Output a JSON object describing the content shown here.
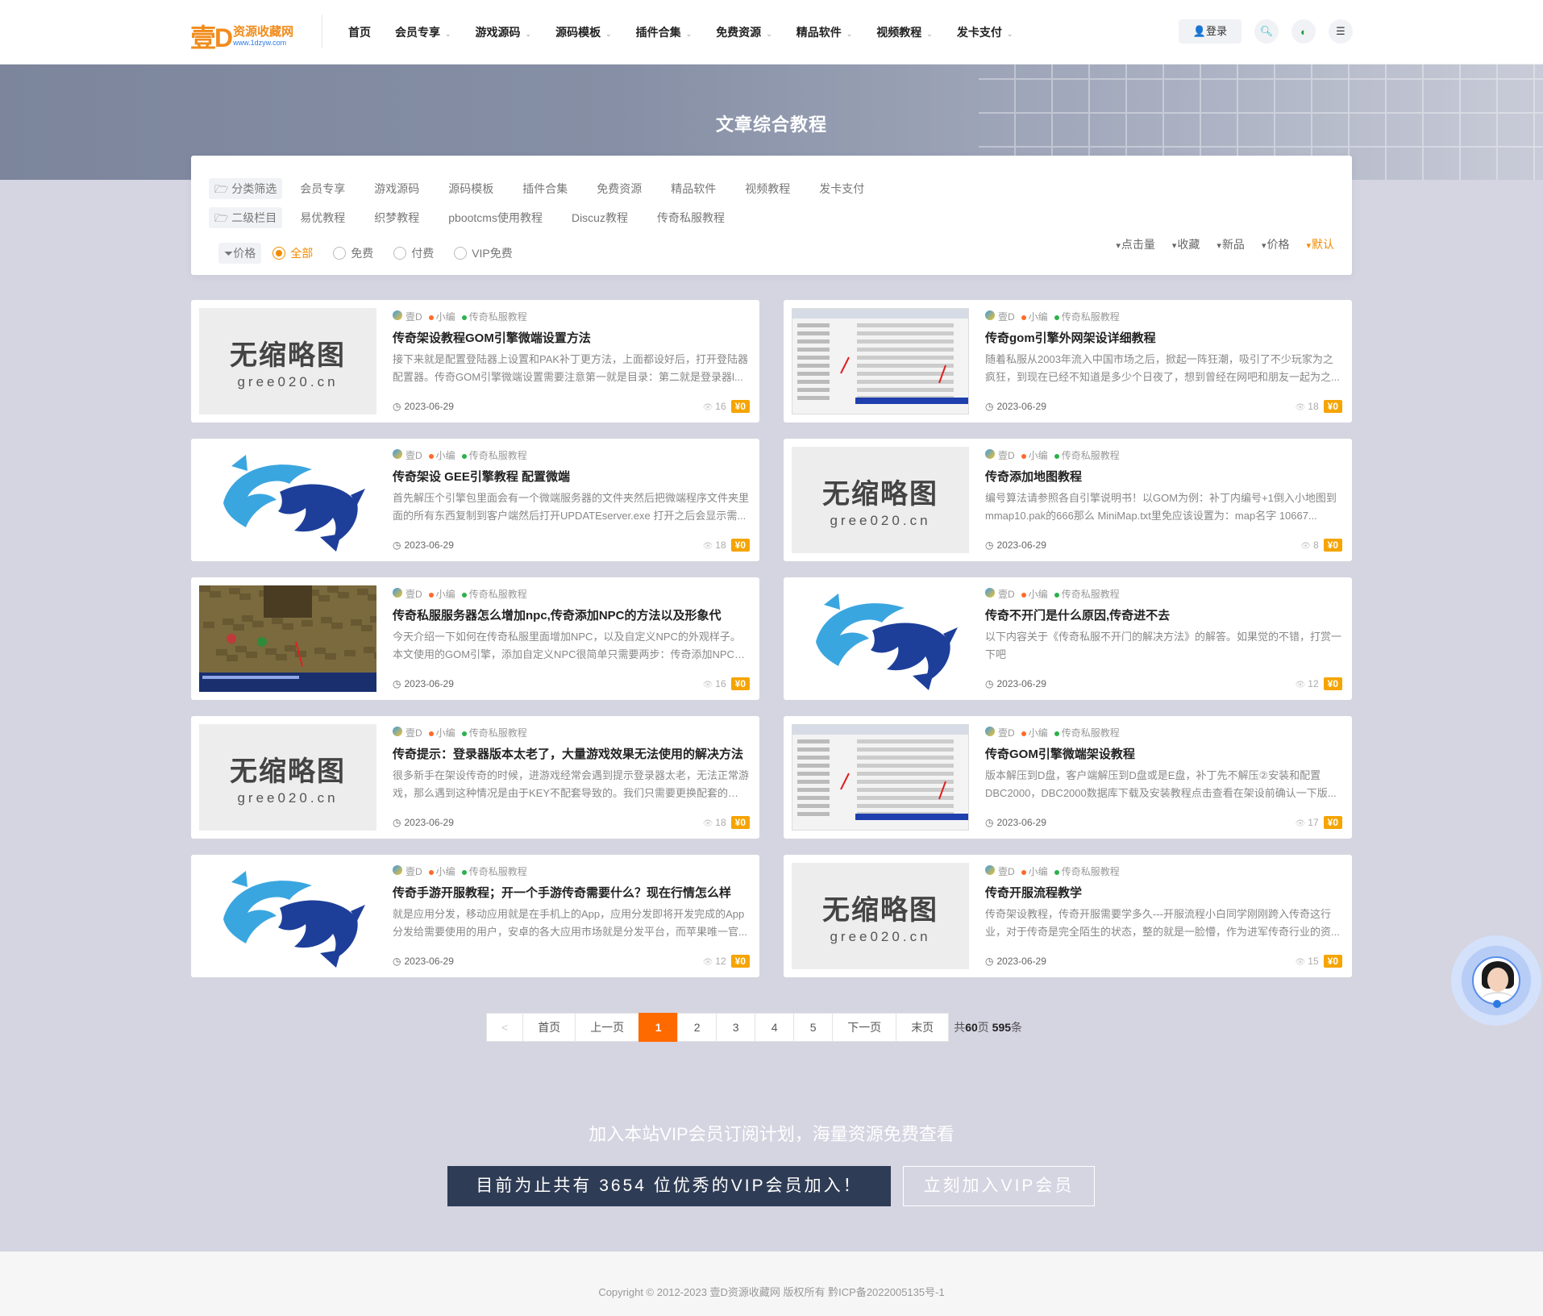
{
  "header": {
    "logo_mark": "壹D",
    "logo_name": "资源收藏网",
    "logo_url": "www.1dzyw.com",
    "nav": [
      {
        "label": "首页",
        "has_caret": false
      },
      {
        "label": "会员专享",
        "has_caret": true
      },
      {
        "label": "游戏源码",
        "has_caret": true
      },
      {
        "label": "源码模板",
        "has_caret": true
      },
      {
        "label": "插件合集",
        "has_caret": true
      },
      {
        "label": "免费资源",
        "has_caret": true
      },
      {
        "label": "精品软件",
        "has_caret": true
      },
      {
        "label": "视频教程",
        "has_caret": true
      },
      {
        "label": "发卡支付",
        "has_caret": true
      }
    ],
    "login_label": "登录",
    "icons": [
      "user-icon",
      "search-icon",
      "theme-toggle-icon",
      "menu-icon"
    ]
  },
  "hero": {
    "title": "文章综合教程"
  },
  "filter": {
    "cat_label": "分类筛选",
    "categories": [
      "会员专享",
      "游戏源码",
      "源码模板",
      "插件合集",
      "免费资源",
      "精品软件",
      "视频教程",
      "发卡支付"
    ],
    "sub_label": "二级栏目",
    "subcategories": [
      "易优教程",
      "织梦教程",
      "pbootcms使用教程",
      "Discuz教程",
      "传奇私服教程"
    ],
    "price_label": "价格",
    "price_options": [
      {
        "label": "全部",
        "selected": true
      },
      {
        "label": "免费",
        "selected": false
      },
      {
        "label": "付费",
        "selected": false
      },
      {
        "label": "VIP免费",
        "selected": false
      }
    ],
    "sorts": [
      {
        "label": "点击量",
        "active": false
      },
      {
        "label": "收藏",
        "active": false
      },
      {
        "label": "新品",
        "active": false
      },
      {
        "label": "价格",
        "active": false
      },
      {
        "label": "默认",
        "active": true
      }
    ]
  },
  "posts": [
    {
      "thumb": "nothumb",
      "site": "壹D",
      "author": "小编",
      "category": "传奇私服教程",
      "title": "传奇架设教程GOM引擎微端设置方法",
      "desc": "接下来就是配置登陆器上设置和PAK补丁更方法，上面都设好后，打开登陆器配置器。传奇GOM引擎微端设置需要注意第一就是目录：第二就是登录器l...",
      "date": "2023-06-29",
      "views": "16",
      "price": "¥0"
    },
    {
      "thumb": "shot",
      "site": "壹D",
      "author": "小编",
      "category": "传奇私服教程",
      "title": "传奇gom引擎外网架设详细教程",
      "desc": "随着私服从2003年流入中国市场之后，掀起一阵狂潮，吸引了不少玩家为之疯狂，到现在已经不知道是多少个日夜了，想到曾经在网吧和朋友一起为之...",
      "date": "2023-06-29",
      "views": "18",
      "price": "¥0"
    },
    {
      "thumb": "fish",
      "site": "壹D",
      "author": "小编",
      "category": "传奇私服教程",
      "title": "传奇架设 GEE引擎教程 配置微端",
      "desc": "首先解压个引擎包里面会有一个微端服务器的文件夹然后把微端程序文件夹里面的所有东西复制到客户端然后打开UPDATEserver.exe 打开之后会显示需...",
      "date": "2023-06-29",
      "views": "18",
      "price": "¥0"
    },
    {
      "thumb": "nothumb",
      "site": "壹D",
      "author": "小编",
      "category": "传奇私服教程",
      "title": "传奇添加地图教程",
      "desc": "编号算法请参照各自引擎说明书！以GOM为例：补丁内编号+1倒入小地图到mmap10.pak的666那么 MiniMap.txt里免应该设置为：map名字 10667...",
      "date": "2023-06-29",
      "views": "8",
      "price": "¥0"
    },
    {
      "thumb": "game",
      "site": "壹D",
      "author": "小编",
      "category": "传奇私服教程",
      "title": "传奇私服服务器怎么增加npc,传奇添加NPC的方法以及形象代",
      "desc": "今天介绍一下如何在传奇私服里面增加NPC，以及自定义NPC的外观样子。本文使用的GOM引擎，添加自定义NPC很简单只需要两步：传奇添加NPC的...",
      "date": "2023-06-29",
      "views": "16",
      "price": "¥0"
    },
    {
      "thumb": "fish",
      "site": "壹D",
      "author": "小编",
      "category": "传奇私服教程",
      "title": "传奇不开门是什么原因,传奇进不去",
      "desc": "以下内容关于《传奇私服不开门的解决方法》的解答。如果觉的不错，打赏一下吧",
      "date": "2023-06-29",
      "views": "12",
      "price": "¥0"
    },
    {
      "thumb": "nothumb",
      "site": "壹D",
      "author": "小编",
      "category": "传奇私服教程",
      "title": "传奇提示：登录器版本太老了，大量游戏效果无法使用的解决方法",
      "desc": "很多新手在架设传奇的时候，进游戏经常会遇到提示登录器太老，无法正常游戏，那么遇到这种情况是由于KEY不配套导致的。我们只需要更换配套的KE...",
      "date": "2023-06-29",
      "views": "18",
      "price": "¥0"
    },
    {
      "thumb": "shot",
      "site": "壹D",
      "author": "小编",
      "category": "传奇私服教程",
      "title": "传奇GOM引擎微端架设教程",
      "desc": "版本解压到D盘，客户端解压到D盘或是E盘，补丁先不解压②安装和配置DBC2000，DBC2000数据库下载及安装教程点击查看在架设前确认一下版...",
      "date": "2023-06-29",
      "views": "17",
      "price": "¥0"
    },
    {
      "thumb": "fish",
      "site": "壹D",
      "author": "小编",
      "category": "传奇私服教程",
      "title": "传奇手游开服教程；开一个手游传奇需要什么？现在行情怎么样",
      "desc": "就是应用分发，移动应用就是在手机上的App，应用分发即将开发完成的App分发给需要使用的用户，安卓的各大应用市场就是分发平台，而苹果唯一官...",
      "date": "2023-06-29",
      "views": "12",
      "price": "¥0"
    },
    {
      "thumb": "nothumb",
      "site": "壹D",
      "author": "小编",
      "category": "传奇私服教程",
      "title": "传奇开服流程教学",
      "desc": "传奇架设教程，传奇开服需要学多久---开服流程小白同学刚刚跨入传奇这行业，对于传奇是完全陌生的状态，整的就是一脸懵，作为进军传奇行业的资...",
      "date": "2023-06-29",
      "views": "15",
      "price": "¥0"
    }
  ],
  "nothumb_text": {
    "line1": "无缩略图",
    "line2": "gree020.cn"
  },
  "pagination": {
    "prev_arrow": "<",
    "first": "首页",
    "prev": "上一页",
    "pages": [
      "1",
      "2",
      "3",
      "4",
      "5"
    ],
    "current": "1",
    "next": "下一页",
    "last": "末页",
    "total_prefix": "共",
    "total_pages": "60",
    "total_pages_suffix": "页",
    "total_items": "595",
    "total_items_suffix": "条"
  },
  "vip": {
    "title": "加入本站VIP会员订阅计划，海量资源免费查看",
    "count_text": "目前为止共有 3654 位优秀的VIP会员加入！",
    "join_label": "立刻加入VIP会员"
  },
  "footer": {
    "copyright": "Copyright © 2012-2023 壹D资源收藏网 版权所有 黔ICP备2022005135号-1"
  },
  "colors": {
    "accent": "#f28c00",
    "price": "#f5a400",
    "active_page": "#ff6a00",
    "vip_dark": "#2f3c55",
    "page_bg": "#d5d4e1"
  }
}
